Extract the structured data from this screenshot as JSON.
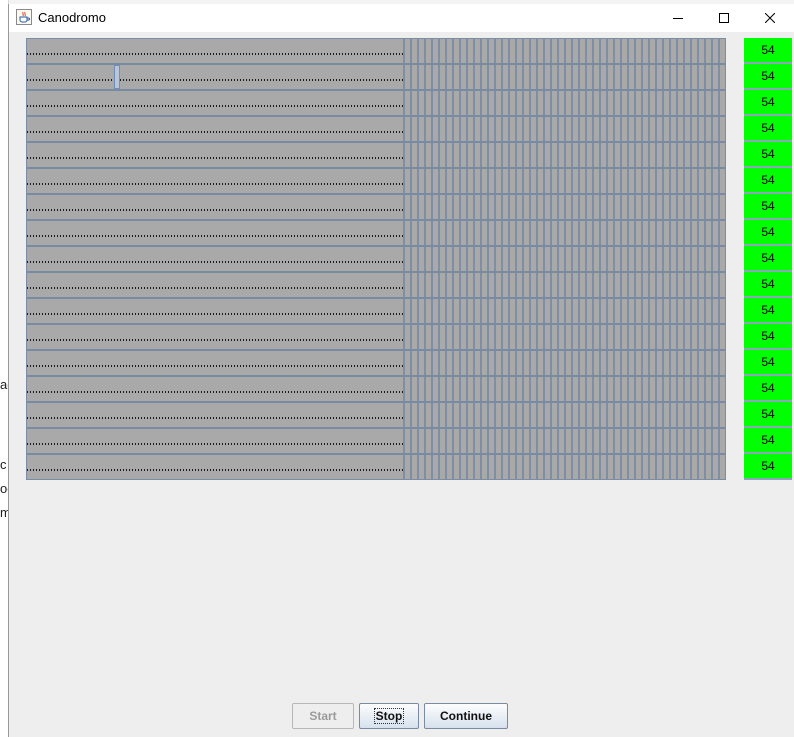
{
  "window": {
    "title": "Canodromo",
    "icons": {
      "app": "java-cup-icon",
      "minimize": "minimize-icon",
      "maximize": "maximize-icon",
      "close": "close-icon"
    }
  },
  "background": {
    "fragments": [
      "ac",
      "c",
      "oc",
      "m"
    ]
  },
  "track": {
    "lane_count": 17,
    "dog_lane": 1,
    "colors": {
      "lane": "#a9a9a9",
      "stripe": "#7f8ea3",
      "result": "#00ff00"
    }
  },
  "results": [
    "54",
    "54",
    "54",
    "54",
    "54",
    "54",
    "54",
    "54",
    "54",
    "54",
    "54",
    "54",
    "54",
    "54",
    "54",
    "54",
    "54"
  ],
  "buttons": {
    "start": "Start",
    "stop": "Stop",
    "continue": "Continue"
  }
}
